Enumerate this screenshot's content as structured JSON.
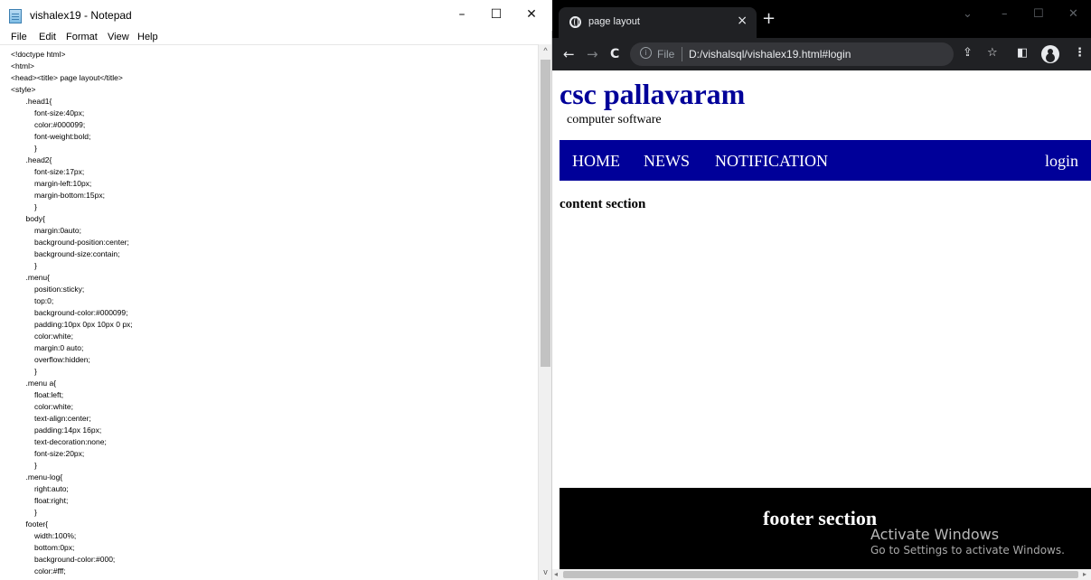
{
  "notepad": {
    "title": "vishalex19 - Notepad",
    "menu": [
      "File",
      "Edit",
      "Format",
      "View",
      "Help"
    ],
    "controls": {
      "minimize": "–",
      "maximize": "☐",
      "close": "✕"
    },
    "code": [
      "<!doctype html>",
      "<html>",
      "<head><title> page layout</title>",
      "<style>",
      "       .head1{",
      "           font-size:40px;",
      "           color:#000099;",
      "           font-weight:bold;",
      "           }",
      "       .head2{",
      "           font-size:17px;",
      "           margin-left:10px;",
      "           margin-bottom:15px;",
      "           }",
      "       body{",
      "           margin:0auto;",
      "           background-position:center;",
      "           background-size:contain;",
      "           }",
      "       .menu{",
      "           position:sticky;",
      "           top:0;",
      "           background-color:#000099;",
      "           padding:10px 0px 10px 0 px;",
      "           color:white;",
      "           margin:0 auto;",
      "           overflow:hidden;",
      "           }",
      "       .menu a{",
      "           float:left;",
      "           color:white;",
      "           text-align:center;",
      "           padding:14px 16px;",
      "           text-decoration:none;",
      "           font-size:20px;",
      "           }",
      "       .menu-log{",
      "           right:auto;",
      "           float:right;",
      "           }",
      "       footer{",
      "           width:100%;",
      "           bottom:0px;",
      "           background-color:#000;",
      "           color:#fff;"
    ]
  },
  "browser": {
    "tab_title": "page layout",
    "tab_close": "×",
    "new_tab": "+",
    "window_controls": {
      "chevron": "⌄",
      "minimize": "–",
      "maximize": "☐",
      "close": "✕"
    },
    "nav": {
      "back": "←",
      "forward": "→",
      "reload": "C"
    },
    "address": {
      "info_icon": "i",
      "scheme_label": "File",
      "url": "D:/vishalsql/vishalex19.html#login"
    },
    "toolbar_icons": {
      "share": "⇪",
      "star": "☆",
      "sidepanel": "◧",
      "menu": "⋮"
    }
  },
  "page": {
    "head1": "csc pallavaram",
    "head2": "computer software",
    "menu_links": [
      "HOME",
      "NEWS",
      "NOTIFICATION"
    ],
    "login": "login",
    "content": "content section",
    "footer": "footer section"
  },
  "overlay": {
    "activate_title": "Activate Windows",
    "activate_sub": "Go to Settings to activate Windows."
  },
  "colors": {
    "brand_blue": "#000099",
    "footer_bg": "#000000",
    "chrome_dark": "#202124"
  }
}
